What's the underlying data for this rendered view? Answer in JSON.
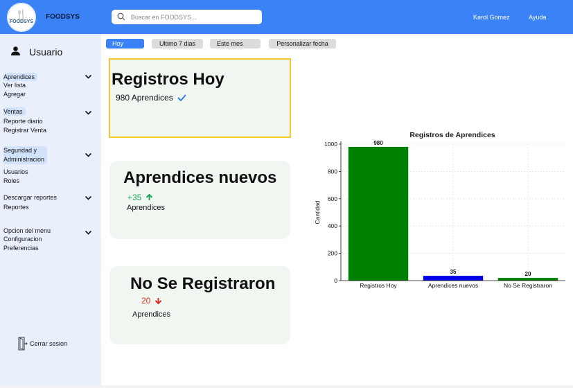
{
  "header": {
    "logo_text": "FOODSYS",
    "brand": "FOODSYS",
    "search_placeholder": "Buscar en FOODSYS...",
    "user_name": "Karol Gomez",
    "help": "Ayuda",
    "colors": {
      "bar": "#3b82f6"
    }
  },
  "sidebar": {
    "user_label": "Usuario",
    "sections": [
      {
        "header": "Aprendices",
        "items": [
          "Ver lista",
          "Agregar"
        ]
      },
      {
        "header": "Ventas",
        "items": [
          "Reporte diario",
          "Registrar Venta"
        ]
      },
      {
        "header_line1": "Seguridad y",
        "header_line2": "Administracion",
        "items": [
          "Usuarios",
          "Roles"
        ]
      },
      {
        "header": "Descargar reportes",
        "items": [
          "Reportes"
        ]
      },
      {
        "header": "Opcion del menu",
        "items": [
          "Configuracion",
          "Preferencias"
        ]
      }
    ],
    "logout": "Cerrar sesion"
  },
  "filters": {
    "active": "Hoy",
    "items": [
      "Hoy",
      "Ultimo 7 dias",
      "Este mes",
      "Personalizar fecha"
    ]
  },
  "cards": [
    {
      "title": "Registros Hoy",
      "stat": "980 Aprendices",
      "stat_icon": "check-icon",
      "selected": true
    },
    {
      "title": "Aprendices nuevos",
      "stat": "+35",
      "stat_icon": "arrow-up-icon",
      "stat_color": "#22a559",
      "sub": "Aprendices"
    },
    {
      "title": "No Se Registraron",
      "stat": "20",
      "stat_icon": "arrow-down-icon",
      "stat_color": "#d93025",
      "sub": "Aprendices"
    }
  ],
  "chart_data": {
    "type": "bar",
    "title": "Registros de Aprendices",
    "ylabel": "Cantidad",
    "xlabel": "",
    "categories": [
      "Registros Hoy",
      "Aprendices nuevos",
      "No Se Registraron"
    ],
    "values": [
      980,
      35,
      20
    ],
    "bar_colors": [
      "#008000",
      "#0000e6",
      "#008000"
    ],
    "data_labels": [
      "980",
      "35",
      "20"
    ],
    "ylim": [
      0,
      1000
    ],
    "yticks": [
      0,
      200,
      400,
      600,
      800,
      1000
    ],
    "grid": true
  }
}
